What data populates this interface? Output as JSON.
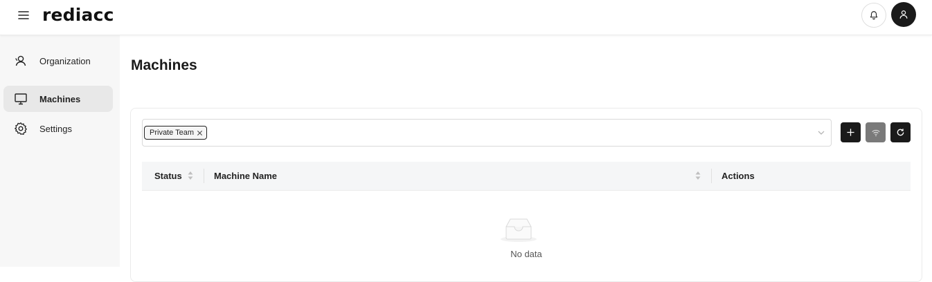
{
  "header": {
    "logo": "rediacc",
    "menu_icon": "hamburger-menu-icon",
    "notification_icon": "bell-icon",
    "user_icon": "user-icon"
  },
  "sidebar": {
    "items": [
      {
        "label": "Organization",
        "icon": "organization-icon",
        "active": false
      },
      {
        "label": "Machines",
        "icon": "monitor-icon",
        "active": true
      },
      {
        "label": "Settings",
        "icon": "gear-icon",
        "active": false
      }
    ]
  },
  "main": {
    "title": "Machines",
    "filter": {
      "selected_tags": [
        "Private Team"
      ]
    },
    "actions": [
      {
        "icon": "plus-icon",
        "color": "#1a1a1a"
      },
      {
        "icon": "wifi-icon",
        "color": "#7a7a7a"
      },
      {
        "icon": "refresh-icon",
        "color": "#1a1a1a"
      }
    ],
    "table": {
      "columns": [
        "Status",
        "Machine Name",
        "Actions"
      ],
      "rows": [],
      "empty_text": "No data"
    }
  },
  "colors": {
    "sidebar_bg": "#f7f7f7",
    "active_item_bg": "#e8e8e8",
    "dark_button": "#1a1a1a",
    "disabled_button": "#7a7a7a"
  }
}
